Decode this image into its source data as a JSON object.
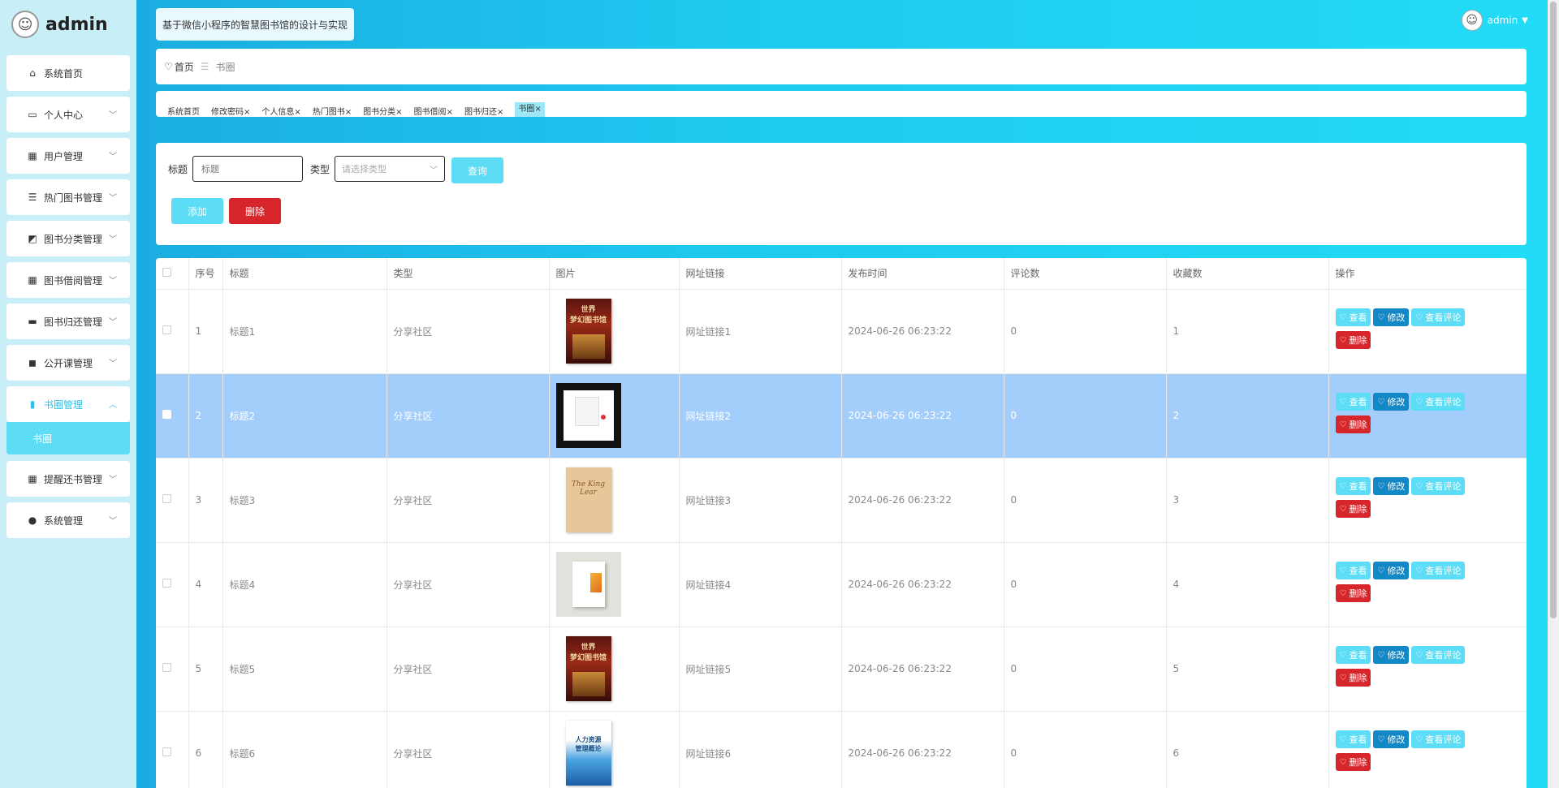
{
  "sidebar": {
    "brand": "admin",
    "menu": [
      {
        "label": "系统首页",
        "icon": "home-icon",
        "glyph": "⌂",
        "has_children": false
      },
      {
        "label": "个人中心",
        "icon": "card-icon",
        "glyph": "▭",
        "has_children": true
      },
      {
        "label": "用户管理",
        "icon": "grid-icon",
        "glyph": "▦",
        "has_children": true
      },
      {
        "label": "热门图书管理",
        "icon": "sliders-icon",
        "glyph": "☰",
        "has_children": true
      },
      {
        "label": "图书分类管理",
        "icon": "chart-icon",
        "glyph": "◩",
        "has_children": true
      },
      {
        "label": "图书借阅管理",
        "icon": "grid-icon",
        "glyph": "▦",
        "has_children": true
      },
      {
        "label": "图书归还管理",
        "icon": "monitor-icon",
        "glyph": "▬",
        "has_children": true
      },
      {
        "label": "公开课管理",
        "icon": "video-icon",
        "glyph": "◼",
        "has_children": true
      },
      {
        "label": "书圈管理",
        "icon": "bar-chart-icon",
        "glyph": "▮",
        "has_children": true,
        "active": true,
        "sub": "书圈"
      },
      {
        "label": "提醒还书管理",
        "icon": "grid-icon",
        "glyph": "▦",
        "has_children": true
      },
      {
        "label": "系统管理",
        "icon": "palette-icon",
        "glyph": "●",
        "has_children": true
      }
    ]
  },
  "header": {
    "system_title": "基于微信小程序的智慧图书馆的设计与实现",
    "user_name": "admin"
  },
  "breadcrumb": {
    "home": "首页",
    "separator": "☰",
    "current": "书圈"
  },
  "tags": [
    "系统首页",
    "修改密码",
    "个人信息",
    "热门图书",
    "图书分类",
    "图书借阅",
    "图书归还",
    "书圈"
  ],
  "search": {
    "title_label": "标题",
    "title_placeholder": "标题",
    "type_label": "类型",
    "type_placeholder": "请选择类型",
    "query_button": "查询",
    "add_button": "添加",
    "delete_button": "删除"
  },
  "table": {
    "columns": [
      "序号",
      "标题",
      "类型",
      "图片",
      "网址链接",
      "发布时间",
      "评论数",
      "收藏数",
      "操作"
    ],
    "actions": {
      "view": "查看",
      "edit": "修改",
      "comments": "查看评论",
      "delete": "删除"
    },
    "rows": [
      {
        "index": "1",
        "title": "标题1",
        "type": "分享社区",
        "link": "网址链接1",
        "time": "2024-06-26 06:23:22",
        "comments": "0",
        "favorites": "1"
      },
      {
        "index": "2",
        "title": "标题2",
        "type": "分享社区",
        "link": "网址链接2",
        "time": "2024-06-26 06:23:22",
        "comments": "0",
        "favorites": "2",
        "selected": true
      },
      {
        "index": "3",
        "title": "标题3",
        "type": "分享社区",
        "link": "网址链接3",
        "time": "2024-06-26 06:23:22",
        "comments": "0",
        "favorites": "3"
      },
      {
        "index": "4",
        "title": "标题4",
        "type": "分享社区",
        "link": "网址链接4",
        "time": "2024-06-26 06:23:22",
        "comments": "0",
        "favorites": "4"
      },
      {
        "index": "5",
        "title": "标题5",
        "type": "分享社区",
        "link": "网址链接5",
        "time": "2024-06-26 06:23:22",
        "comments": "0",
        "favorites": "5"
      },
      {
        "index": "6",
        "title": "标题6",
        "type": "分享社区",
        "link": "网址链接6",
        "time": "2024-06-26 06:23:22",
        "comments": "0",
        "favorites": "6"
      }
    ]
  },
  "colors": {
    "accent": "#5ddcf6",
    "edit": "#1388c6",
    "danger": "#d6262b",
    "selected_row": "#a3cefc"
  }
}
